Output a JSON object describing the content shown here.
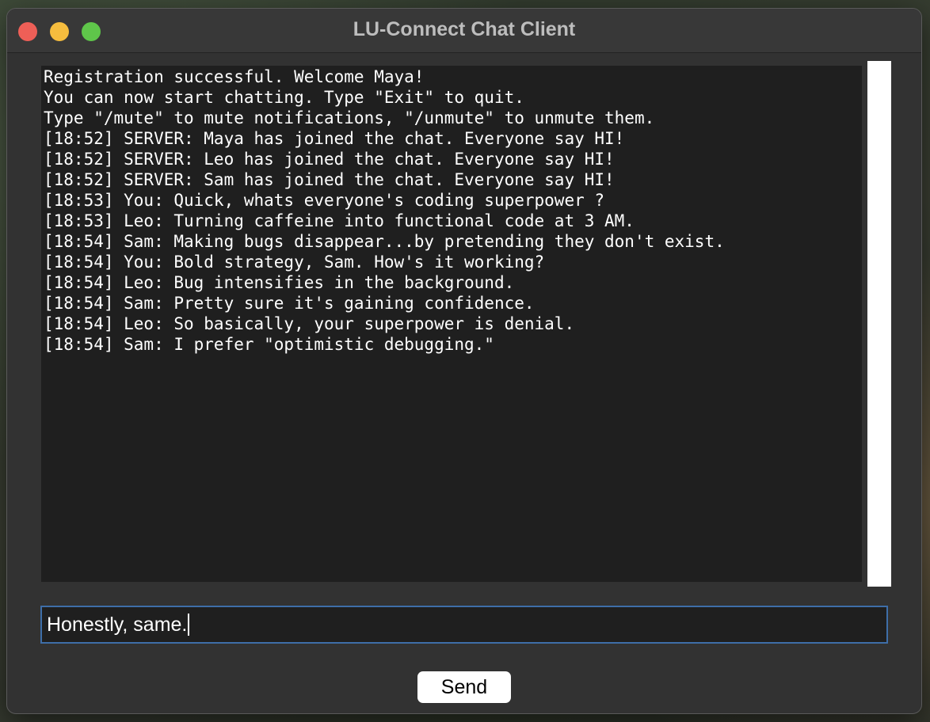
{
  "window": {
    "title": "LU-Connect Chat Client"
  },
  "chat": {
    "lines": [
      "Registration successful. Welcome Maya!",
      "You can now start chatting. Type \"Exit\" to quit.",
      "Type \"/mute\" to mute notifications, \"/unmute\" to unmute them.",
      "[18:52] SERVER: Maya has joined the chat. Everyone say HI!",
      "[18:52] SERVER: Leo has joined the chat. Everyone say HI!",
      "[18:52] SERVER: Sam has joined the chat. Everyone say HI!",
      "[18:53] You: Quick, whats everyone's coding superpower ?",
      "[18:53] Leo: Turning caffeine into functional code at 3 AM.",
      "[18:54] Sam: Making bugs disappear...by pretending they don't exist.",
      "[18:54] You: Bold strategy, Sam. How's it working?",
      "[18:54] Leo: Bug intensifies in the background.",
      "[18:54] Sam: Pretty sure it's gaining confidence.",
      "[18:54] Leo: So basically, your superpower is denial.",
      "[18:54] Sam: I prefer \"optimistic debugging.\""
    ]
  },
  "input": {
    "value": "Honestly, same."
  },
  "send": {
    "label": "Send"
  },
  "colors": {
    "close": "#ee5f57",
    "minimize": "#f6bd3e",
    "maximize": "#5fc64a",
    "input_focus_border": "#3e6ea8"
  }
}
